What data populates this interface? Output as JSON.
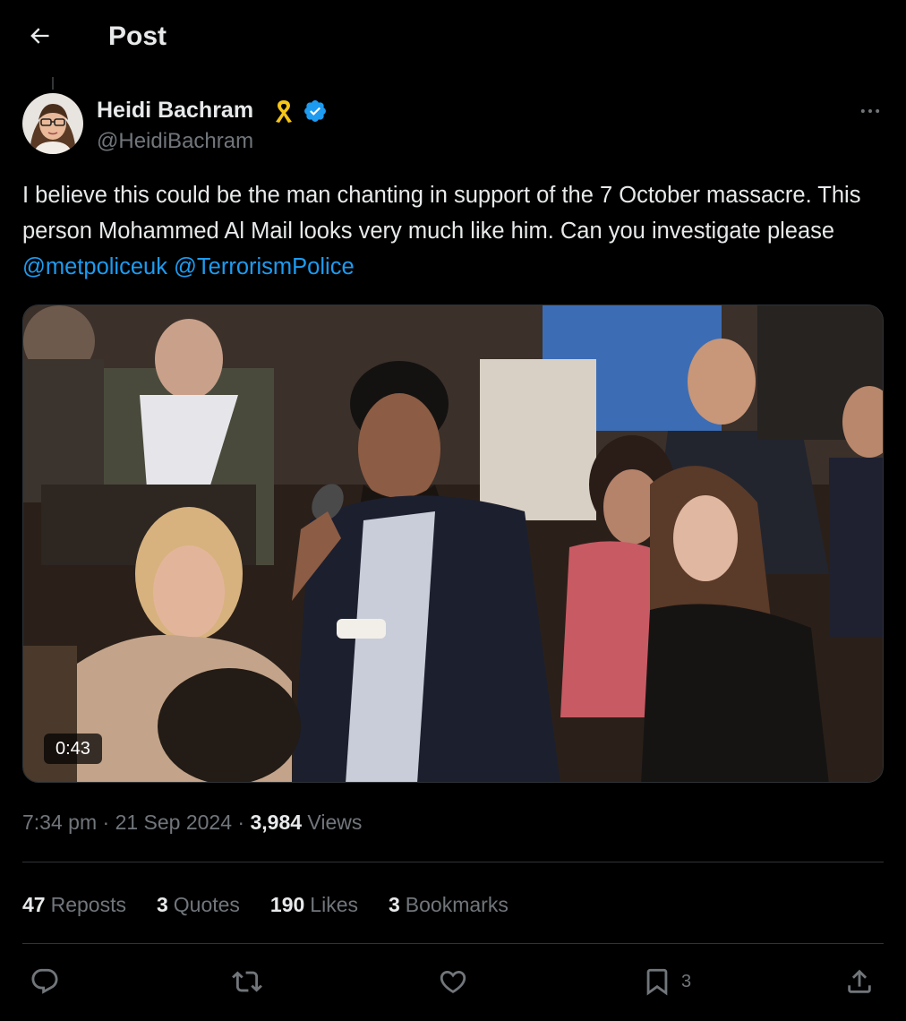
{
  "header": {
    "title": "Post"
  },
  "author": {
    "name": "Heidi Bachram",
    "handle": "@HeidiBachram"
  },
  "post": {
    "text_part1": "I believe this could be the man chanting in support of the 7 October massacre. This person Mohammed Al Mail looks very much like him. Can you investigate please ",
    "mention1": "@metpoliceuk",
    "mention2": "@TerrorismPolice"
  },
  "media": {
    "duration": "0:43"
  },
  "meta": {
    "time": "7:34 pm",
    "separator": "·",
    "date": "21 Sep 2024",
    "views_count": "3,984",
    "views_label": "Views"
  },
  "stats": {
    "reposts_count": "47",
    "reposts_label": "Reposts",
    "quotes_count": "3",
    "quotes_label": "Quotes",
    "likes_count": "190",
    "likes_label": "Likes",
    "bookmarks_count": "3",
    "bookmarks_label": "Bookmarks"
  },
  "actions": {
    "bookmark_count": "3",
    "icons": [
      "reply-icon",
      "repost-icon",
      "like-icon",
      "bookmark-icon",
      "share-icon"
    ]
  },
  "colors": {
    "background": "#000000",
    "text_primary": "#e7e9ea",
    "text_secondary": "#71767b",
    "link": "#1d9bf0",
    "divider": "#2f3336",
    "verified": "#1d9bf0",
    "ribbon": "#f5c518"
  }
}
